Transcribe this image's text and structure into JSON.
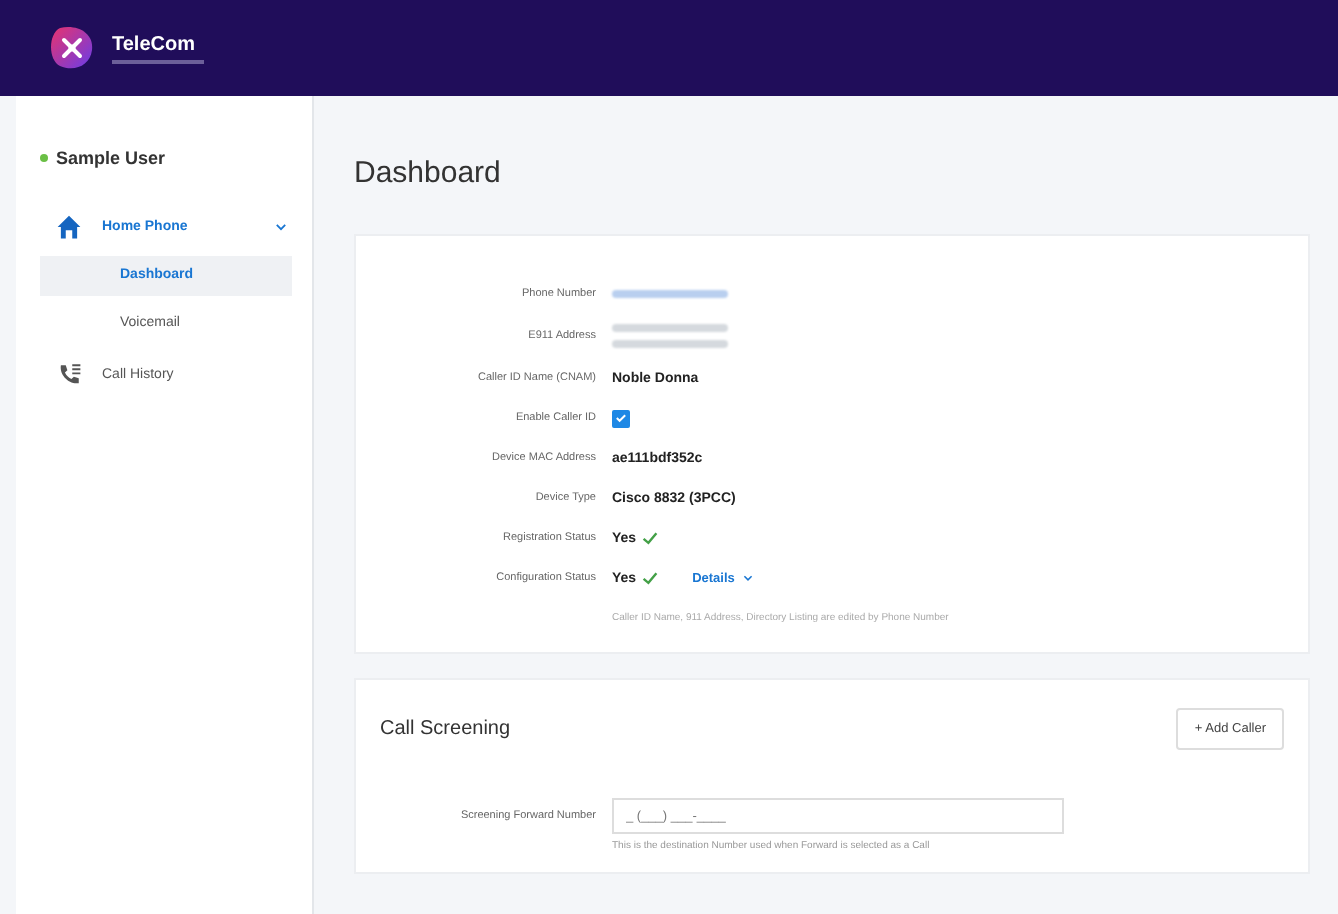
{
  "header": {
    "brand": "TeleCom"
  },
  "sidebar": {
    "user": {
      "name": "Sample User",
      "online": true
    },
    "items": [
      {
        "label": "Home Phone",
        "expanded": true,
        "children": [
          {
            "label": "Dashboard",
            "selected": true
          },
          {
            "label": "Voicemail",
            "selected": false
          }
        ]
      },
      {
        "label": "Call History"
      }
    ]
  },
  "page_title": "Dashboard",
  "details": {
    "fields": [
      {
        "label": "Phone Number",
        "kind": "redacted-link"
      },
      {
        "label": "E911 Address",
        "kind": "redacted-block"
      },
      {
        "label": "Caller ID Name (CNAM)",
        "kind": "text",
        "value": "Noble Donna"
      },
      {
        "label": "Enable Caller ID",
        "kind": "checkbox",
        "checked": true
      },
      {
        "label": "Device MAC Address",
        "kind": "text",
        "value": "ae111bdf352c"
      },
      {
        "label": "Device Type",
        "kind": "text",
        "value": "Cisco 8832 (3PCC)"
      },
      {
        "label": "Registration Status",
        "kind": "status",
        "value": "Yes",
        "ok": true
      },
      {
        "label": "Configuration Status",
        "kind": "status",
        "value": "Yes",
        "ok": true,
        "action": "Details"
      }
    ],
    "note": "Caller ID Name, 911 Address, Directory Listing are edited by Phone Number"
  },
  "call_screening": {
    "title": "Call Screening",
    "button": "+ Add Caller",
    "field_label": "Screening Forward Number",
    "placeholder": "_ (___) ___-____",
    "help": "This is the destination Number used when Forward is selected as a Call"
  }
}
